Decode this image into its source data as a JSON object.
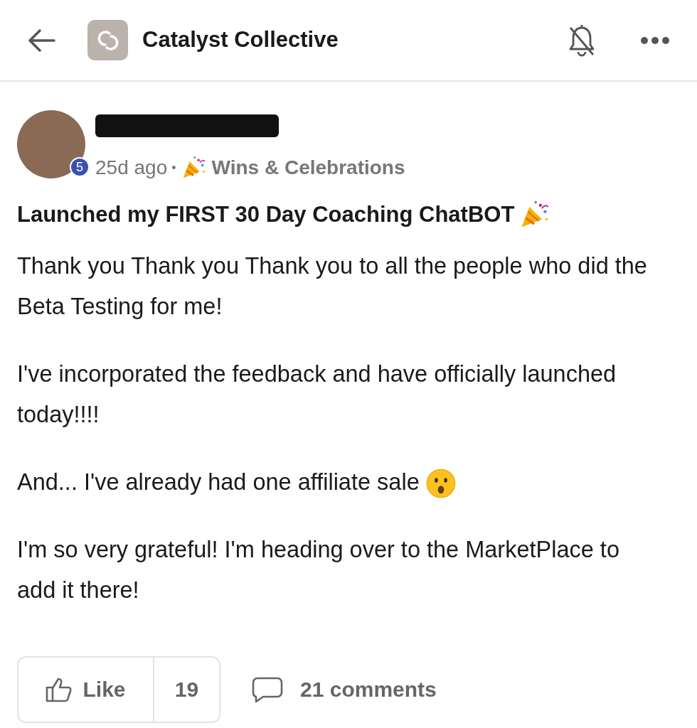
{
  "header": {
    "title": "Catalyst Collective"
  },
  "post": {
    "author_level": "5",
    "time": "25d ago",
    "separator": "•",
    "category": "Wins & Celebrations",
    "title": "Launched my FIRST 30 Day Coaching ChatBOT",
    "paragraphs": [
      {
        "kind": "plain",
        "text": "Thank you Thank you Thank you to all the people who did the Beta Testing for me!"
      },
      {
        "kind": "plain",
        "text": "I've incorporated the feedback and have officially launched today!!!!"
      },
      {
        "kind": "with_emoji",
        "text": "And... I've already had one affiliate sale"
      },
      {
        "kind": "plain",
        "text": "I'm so very grateful! I'm heading over to the MarketPlace to add it there!"
      }
    ],
    "like_label": "Like",
    "like_count": "19",
    "comments": "21 comments"
  }
}
